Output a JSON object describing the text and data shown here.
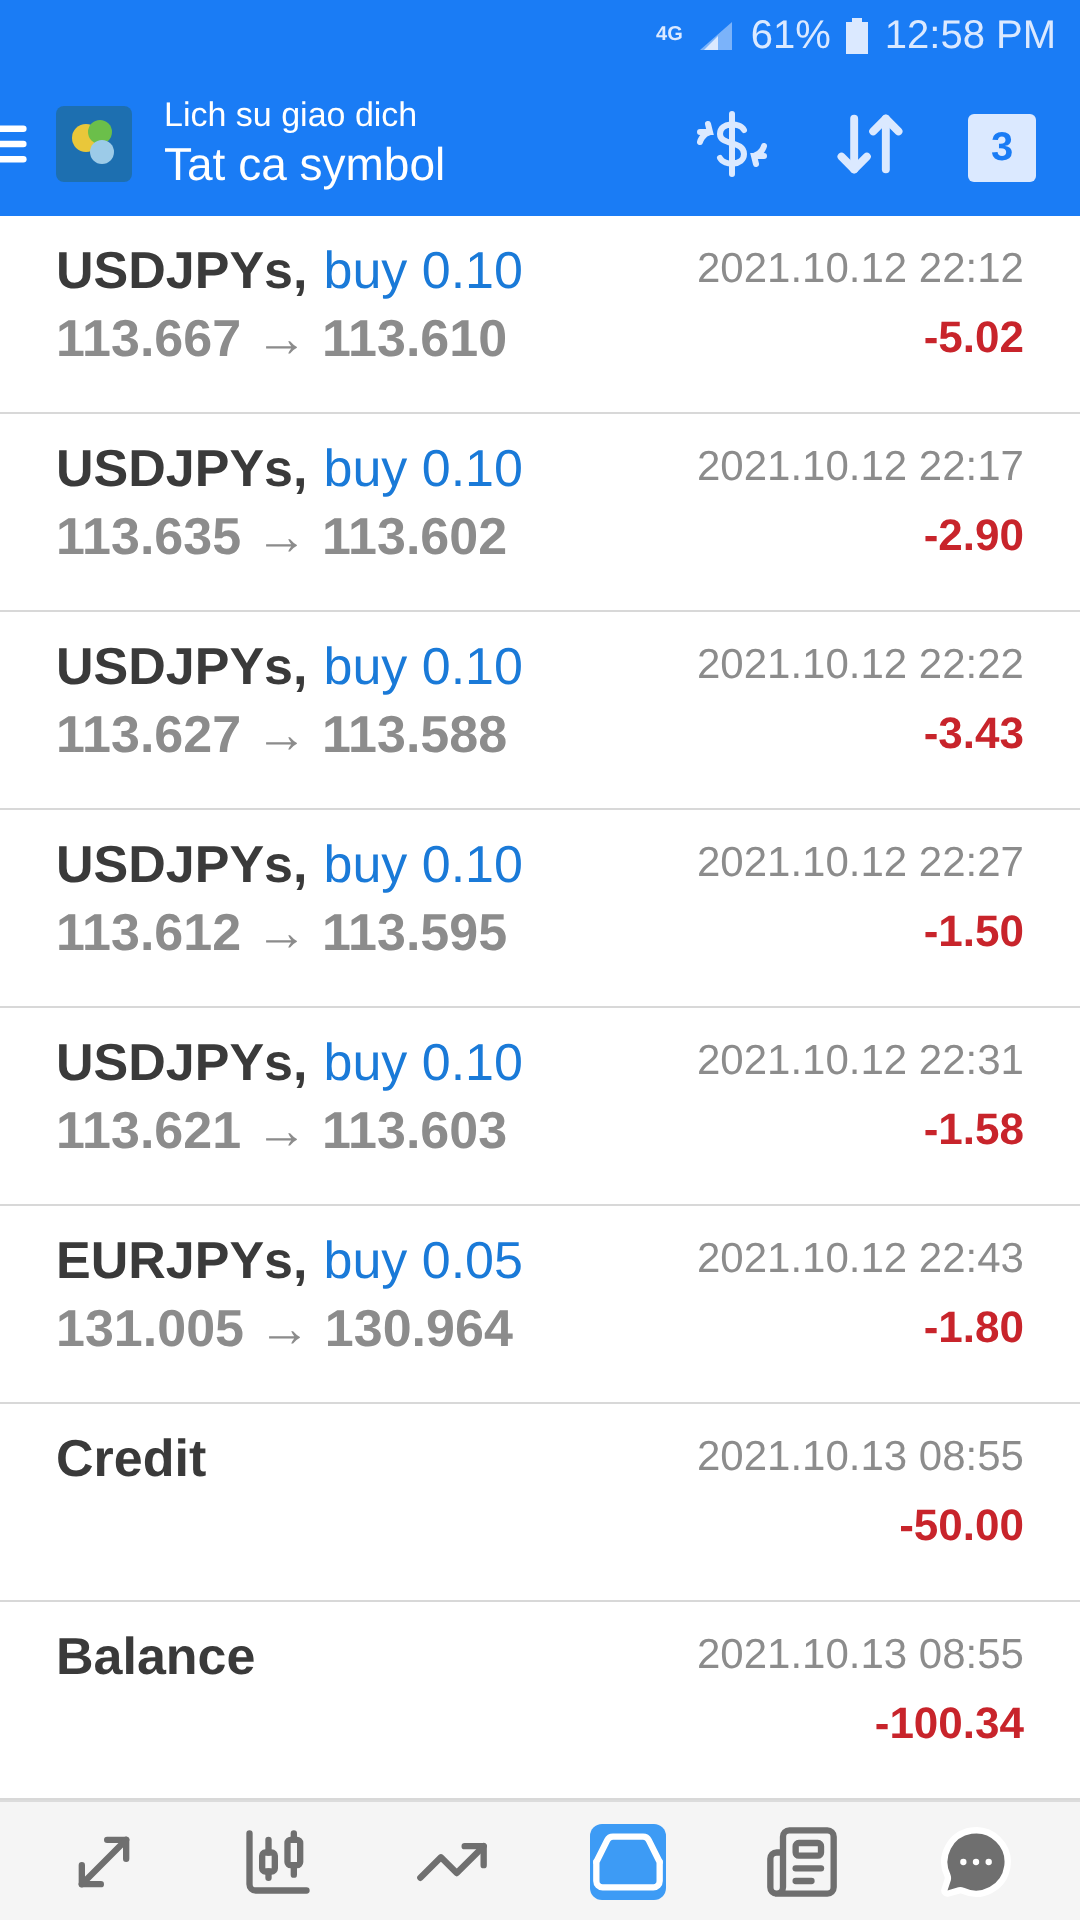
{
  "status_bar": {
    "network": "4G",
    "battery": "61%",
    "time": "12:58 PM"
  },
  "app_bar": {
    "subtitle": "Lich su giao dich",
    "title": "Tat ca symbol",
    "calendar_day": "3"
  },
  "rows": [
    {
      "kind": "trade",
      "symbol": "USDJPYs,",
      "order": "buy 0.10",
      "prices": "113.667 → 113.610",
      "time": "2021.10.12 22:12",
      "profit": "-5.02"
    },
    {
      "kind": "trade",
      "symbol": "USDJPYs,",
      "order": "buy 0.10",
      "prices": "113.635 → 113.602",
      "time": "2021.10.12 22:17",
      "profit": "-2.90"
    },
    {
      "kind": "trade",
      "symbol": "USDJPYs,",
      "order": "buy 0.10",
      "prices": "113.627 → 113.588",
      "time": "2021.10.12 22:22",
      "profit": "-3.43"
    },
    {
      "kind": "trade",
      "symbol": "USDJPYs,",
      "order": "buy 0.10",
      "prices": "113.612 → 113.595",
      "time": "2021.10.12 22:27",
      "profit": "-1.50"
    },
    {
      "kind": "trade",
      "symbol": "USDJPYs,",
      "order": "buy 0.10",
      "prices": "113.621 → 113.603",
      "time": "2021.10.12 22:31",
      "profit": "-1.58"
    },
    {
      "kind": "trade",
      "symbol": "EURJPYs,",
      "order": "buy 0.05",
      "prices": "131.005 → 130.964",
      "time": "2021.10.12 22:43",
      "profit": "-1.80"
    },
    {
      "kind": "balance",
      "symbol": "Credit",
      "time": "2021.10.13 08:55",
      "profit": "-50.00"
    },
    {
      "kind": "balance",
      "symbol": "Balance",
      "time": "2021.10.13 08:55",
      "profit": "-100.34"
    }
  ],
  "nav": [
    {
      "kind": "trade",
      "selected": false
    },
    {
      "kind": "quotes",
      "selected": false
    },
    {
      "kind": "chart",
      "selected": false
    },
    {
      "kind": "history",
      "selected": true
    },
    {
      "kind": "news",
      "selected": false
    },
    {
      "kind": "chat",
      "selected": false
    }
  ]
}
